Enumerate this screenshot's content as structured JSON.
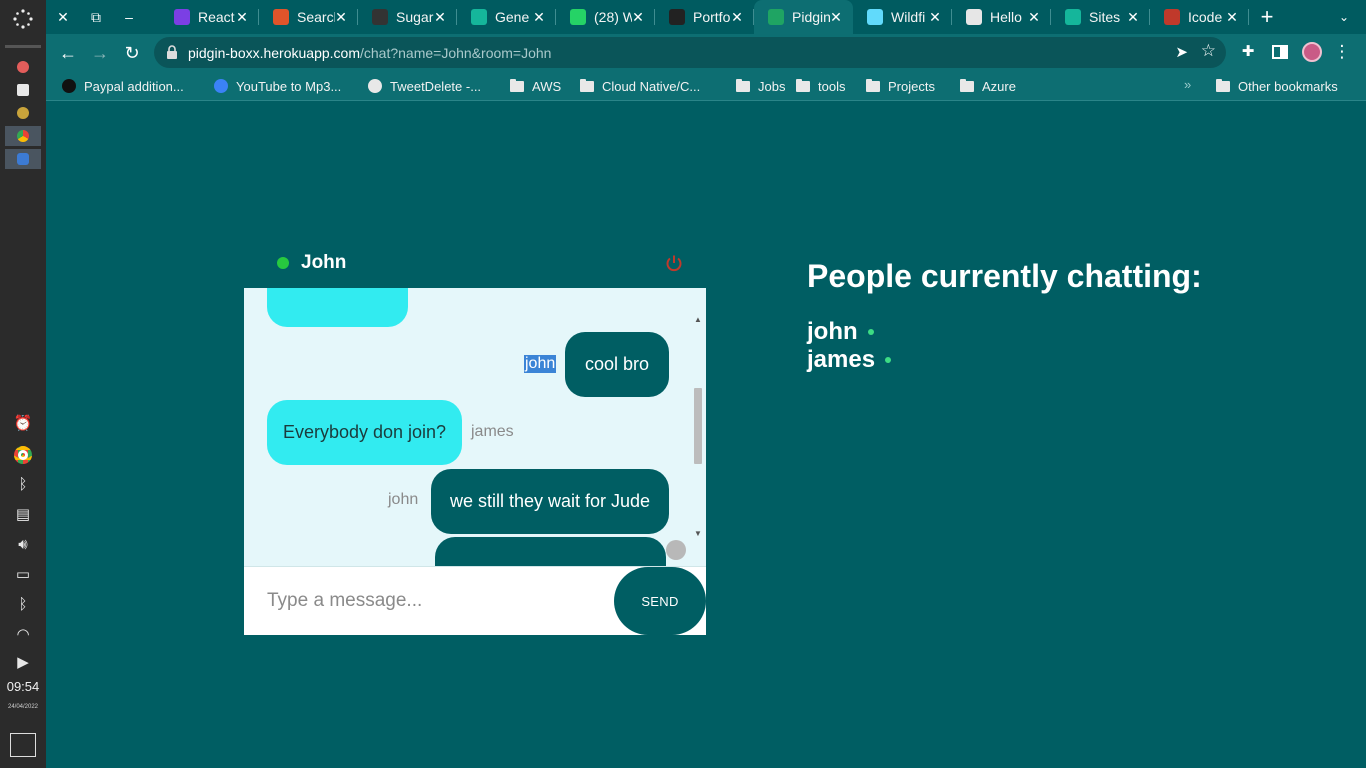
{
  "system": {
    "clock": "09:54",
    "date": "24/04/2022"
  },
  "browser": {
    "tabs": [
      {
        "title": "React",
        "favicon_color": "#7b3fe4",
        "active": false
      },
      {
        "title": "Search",
        "favicon_color": "#e0542a",
        "active": false
      },
      {
        "title": "Sugar",
        "favicon_color": "#333333",
        "active": false
      },
      {
        "title": "Gene",
        "favicon_color": "#15b69b",
        "active": false
      },
      {
        "title": "(28) W",
        "favicon_color": "#25d366",
        "active": false
      },
      {
        "title": "Portfo",
        "favicon_color": "#222222",
        "active": false
      },
      {
        "title": "Pidgin",
        "favicon_color": "#1fa463",
        "active": true
      },
      {
        "title": "Wildfi",
        "favicon_color": "#61dafb",
        "active": false
      },
      {
        "title": "Hello",
        "favicon_color": "#e6e6e6",
        "active": false
      },
      {
        "title": "Sites",
        "favicon_color": "#15b69b",
        "active": false
      },
      {
        "title": "Icode",
        "favicon_color": "#c0392b",
        "active": false
      }
    ],
    "url_host": "pidgin-boxx.herokuapp.com",
    "url_path": "/chat?name=John&room=John",
    "bookmarks": [
      {
        "label": "Paypal addition...",
        "type": "site"
      },
      {
        "label": "YouTube to Mp3...",
        "type": "site"
      },
      {
        "label": "TweetDelete -...",
        "type": "site"
      },
      {
        "label": "AWS",
        "type": "folder"
      },
      {
        "label": "Cloud Native/C...",
        "type": "folder"
      },
      {
        "label": "Jobs",
        "type": "folder"
      },
      {
        "label": "tools",
        "type": "folder"
      },
      {
        "label": "Projects",
        "type": "folder"
      },
      {
        "label": "Azure",
        "type": "folder"
      }
    ],
    "other_bookmarks": "Other bookmarks"
  },
  "chat": {
    "room_name": "John",
    "messages": [
      {
        "sender": "john",
        "text": "cool bro",
        "mine": true
      },
      {
        "sender": "james",
        "text": "Everybody don join?",
        "mine": false
      },
      {
        "sender": "john",
        "text": "we still they wait for Jude",
        "mine": true
      }
    ],
    "input_placeholder": "Type a message...",
    "send_label": "SEND"
  },
  "people": {
    "title": "People currently chatting:",
    "users": [
      "john",
      "james"
    ]
  },
  "colors": {
    "page_bg": "#005e63",
    "own_bubble": "#005e63",
    "other_bubble": "#32ebf0",
    "online": "#27c93f"
  }
}
